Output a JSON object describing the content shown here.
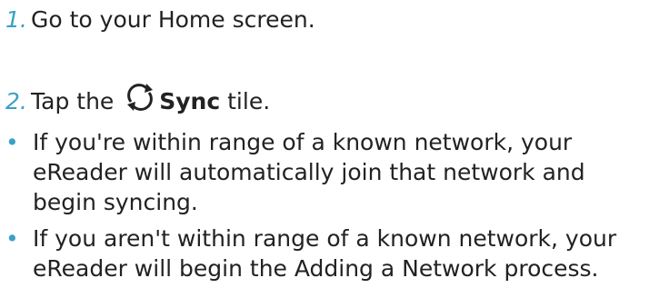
{
  "steps": [
    {
      "number": "1.",
      "text": "Go to your Home screen."
    },
    {
      "number": "2.",
      "prefix": "Tap the",
      "bold": "Sync",
      "suffix": "tile.",
      "icon": "sync-icon"
    }
  ],
  "bullets": [
    {
      "marker": "•",
      "lines": [
        "If you're within range of a known network, your",
        "eReader will automatically join that network and",
        "begin syncing."
      ]
    },
    {
      "marker": "•",
      "lines": [
        "If you aren't within range of a known network, your",
        "eReader will begin the Adding a Network process."
      ]
    }
  ],
  "colors": {
    "accent": "#3aa0c8",
    "text": "#222222"
  }
}
